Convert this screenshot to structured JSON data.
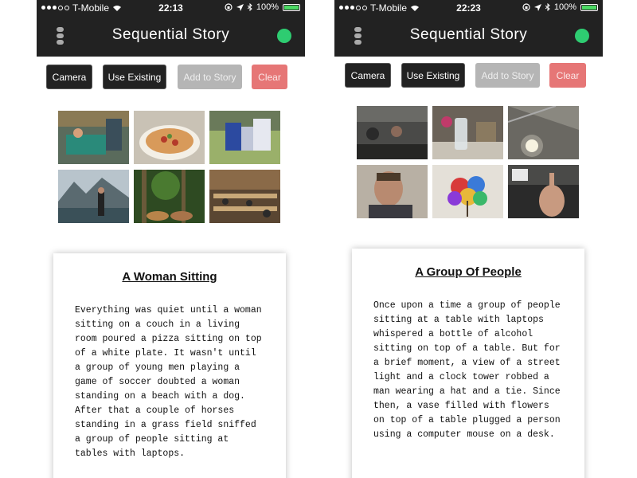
{
  "screens": [
    {
      "carrier": "T-Mobile",
      "time": "22:13",
      "battery": "100%",
      "nav_title": "Sequential Story",
      "buttons": {
        "camera": "Camera",
        "use_existing": "Use Existing",
        "add": "Add to Story",
        "clear": "Clear"
      },
      "story_title": "A Woman Sitting",
      "story_text": "Everything was quiet until a woman sitting on a couch in a living room poured a pizza sitting on top of a white plate. It wasn't until a group of young men playing a game of soccer doubted a woman standing on a beach with a dog. After that a couple of horses standing in a grass field sniffed a group of people sitting at tables with laptops."
    },
    {
      "carrier": "T-Mobile",
      "time": "22:23",
      "battery": "100%",
      "nav_title": "Sequential Story",
      "buttons": {
        "camera": "Camera",
        "use_existing": "Use Existing",
        "add": "Add to Story",
        "clear": "Clear"
      },
      "story_title": "A Group Of People",
      "story_text": "Once upon a time a group of people sitting at a table with laptops whispered a bottle of alcohol sitting on top of a table. But for a brief moment, a view of a street light and a clock tower robbed a man wearing a hat and a tie. Since then, a vase filled with flowers on top of a table plugged a person using a computer mouse on a desk."
    }
  ],
  "colors": {
    "bar": "#222222",
    "connected": "#2ecc71",
    "disabled": "#b5b5b5",
    "danger": "#e67676"
  },
  "icons": [
    "wifi-icon",
    "lock-rotation-icon",
    "location-icon",
    "bluetooth-icon",
    "battery-icon",
    "menu-icon",
    "status-dot-icon"
  ]
}
